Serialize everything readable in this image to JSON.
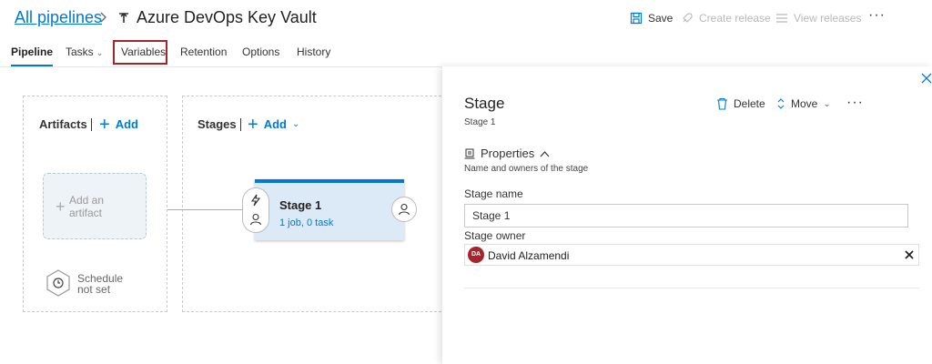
{
  "header": {
    "breadcrumb": "All pipelines",
    "pipeline_name": "Azure DevOps Key Vault",
    "save_label": "Save",
    "create_release_label": "Create release",
    "view_releases_label": "View releases",
    "more_label": "···"
  },
  "tabs": [
    {
      "label": "Pipeline",
      "active": true
    },
    {
      "label": "Tasks",
      "has_dropdown": true
    },
    {
      "label": "Variables",
      "highlighted": true
    },
    {
      "label": "Retention"
    },
    {
      "label": "Options"
    },
    {
      "label": "History"
    }
  ],
  "canvas": {
    "artifacts": {
      "title": "Artifacts",
      "add_label": "Add",
      "add_artifact_label": "Add an artifact",
      "schedule_label": "Schedule not set"
    },
    "stages": {
      "title": "Stages",
      "add_label": "Add",
      "stage": {
        "name": "Stage 1",
        "summary": "1 job, 0 task"
      }
    }
  },
  "panel": {
    "title": "Stage",
    "subtitle": "Stage 1",
    "delete_label": "Delete",
    "move_label": "Move",
    "more_label": "···",
    "properties": {
      "header": "Properties",
      "description": "Name and owners of the stage",
      "stage_name_label": "Stage name",
      "stage_name_value": "Stage 1",
      "stage_owner_label": "Stage owner",
      "owner": {
        "initials": "DA",
        "name": "David Alzamendi"
      }
    }
  },
  "colors": {
    "accent": "#0078d4",
    "highlight_border": "#a4262c",
    "owner_avatar": "#a4262c",
    "stage_card_bg": "#dce9f6"
  }
}
